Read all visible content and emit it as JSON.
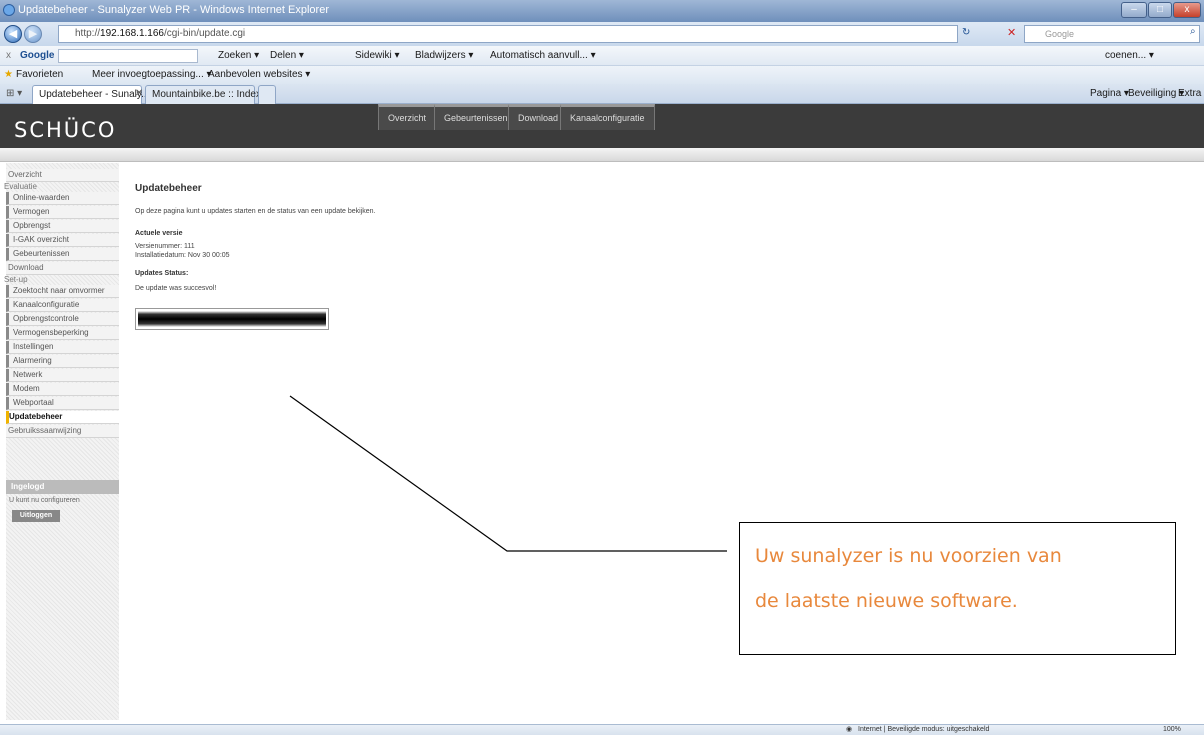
{
  "window": {
    "title": "Updatebeheer - Sunalyzer Web PR - Windows Internet Explorer",
    "url_prefix": "http://",
    "url_host": "192.168.1.166",
    "url_path": "/cgi-bin/update.cgi",
    "search_placeholder": "Google"
  },
  "google_toolbar": {
    "close": "x",
    "brand": "Google",
    "items": [
      "Zoeken ▾",
      "Delen ▾",
      "Sidewiki ▾",
      "Bladwijzers ▾",
      "Automatisch aanvull... ▾"
    ],
    "account": "coenen... ▾"
  },
  "favorites_bar": {
    "favorites": "Favorieten",
    "items": [
      "Meer invoegtoepassing... ▾",
      "Aanbevolen websites ▾"
    ]
  },
  "tabs": [
    {
      "label": "Updatebeheer - Sunaly...",
      "active": true
    },
    {
      "label": "Mountainbike.be :: Index",
      "active": false
    }
  ],
  "command_bar": [
    "Pagina ▾",
    "Beveiliging ▾",
    "Extra ▾"
  ],
  "page": {
    "logo": "SCHÜCO",
    "top_nav": [
      "Overzicht",
      "Gebeurtenissen",
      "Download",
      "Kanaalconfiguratie"
    ],
    "sidebar": [
      {
        "label": "Overzicht",
        "type": "head"
      },
      {
        "label": "Evaluatie",
        "type": "section"
      },
      {
        "label": "Online-waarden",
        "type": "item"
      },
      {
        "label": "Vermogen",
        "type": "item"
      },
      {
        "label": "Opbrengst",
        "type": "item"
      },
      {
        "label": "I-GAK overzicht",
        "type": "item"
      },
      {
        "label": "Gebeurtenissen",
        "type": "item"
      },
      {
        "label": "Download",
        "type": "head"
      },
      {
        "label": "Set-up",
        "type": "section"
      },
      {
        "label": "Zoektocht naar omvormer",
        "type": "item"
      },
      {
        "label": "Kanaalconfiguratie",
        "type": "item"
      },
      {
        "label": "Opbrengstcontrole",
        "type": "item"
      },
      {
        "label": "Vermogensbeperking",
        "type": "item"
      },
      {
        "label": "Instellingen",
        "type": "item"
      },
      {
        "label": "Alarmering",
        "type": "item"
      },
      {
        "label": "Netwerk",
        "type": "item"
      },
      {
        "label": "Modem",
        "type": "item"
      },
      {
        "label": "Webportaal",
        "type": "item"
      },
      {
        "label": "Updatebeheer",
        "type": "active"
      },
      {
        "label": "Gebruikssaanwijzing",
        "type": "head"
      }
    ],
    "login": {
      "heading": "Ingelogd",
      "text": "U kunt nu configureren",
      "logout": "Uitloggen"
    },
    "content": {
      "title": "Updatebeheer",
      "intro": "Op deze pagina kunt u updates starten en de status van een update bekijken.",
      "current_heading": "Actuele versie",
      "version": "Versienummer: 111",
      "install_date": "Installatiedatum: Nov 30 00:05",
      "status_heading": "Updates Status:",
      "status_text": "De update was succesvol!",
      "progress": 1.0
    }
  },
  "annotation": {
    "line1": "Uw sunalyzer is nu voorzien van",
    "line2": "de laatste nieuwe software."
  },
  "statusbar": {
    "zone": "Internet | Beveiligde modus: uitgeschakeld",
    "zoom": "100%"
  }
}
